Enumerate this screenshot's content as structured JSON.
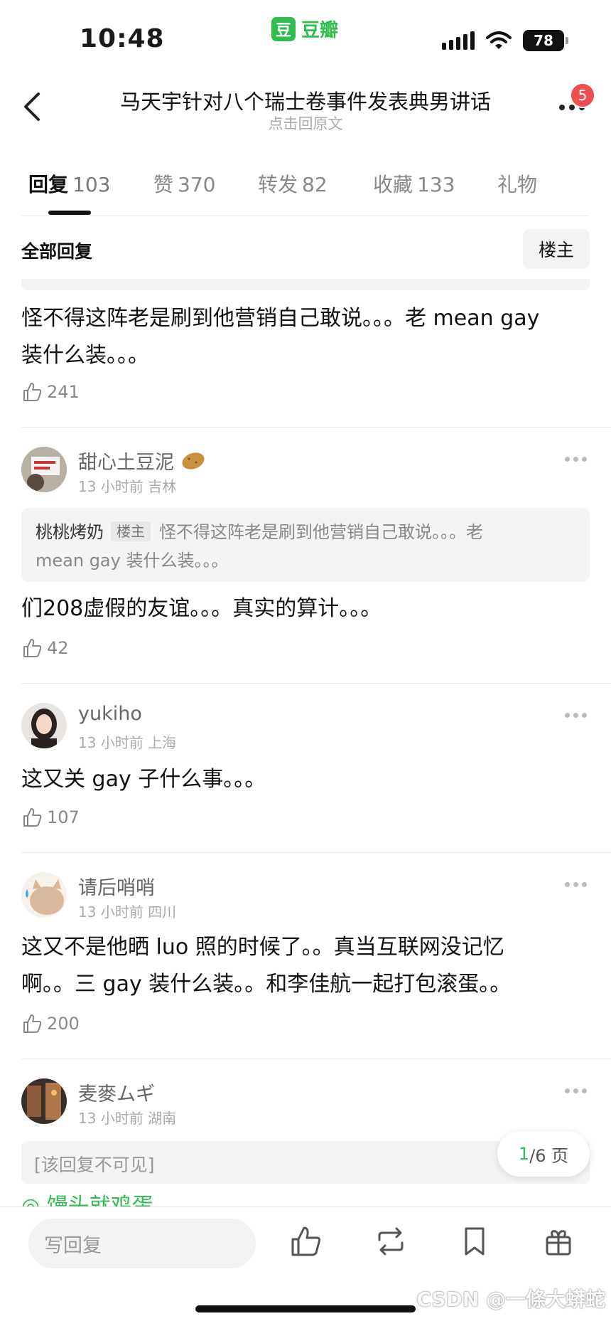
{
  "status_bar": {
    "time": "10:48",
    "app_icon_glyph": "豆",
    "app_name": "豆瓣",
    "battery": "78"
  },
  "nav": {
    "title": "马天宇针对八个瑞士卷事件发表典男讲话",
    "subtitle": "点击回原文",
    "notification_count": "5"
  },
  "tabs": [
    {
      "label": "回复",
      "count": "103",
      "active": true
    },
    {
      "label": "赞",
      "count": "370"
    },
    {
      "label": "转发",
      "count": "82"
    },
    {
      "label": "收藏",
      "count": "133"
    },
    {
      "label": "礼物",
      "count": ""
    }
  ],
  "filter": {
    "label": "全部回复",
    "op_button": "楼主"
  },
  "comments": [
    {
      "text_lines": [
        "怪不得这阵老是刷到他营销自己敢说。。。老 mean gay",
        "装什么装。。。"
      ],
      "likes": "241"
    },
    {
      "username": "甜心土豆泥",
      "time": "13 小时前",
      "location": "吉林",
      "quote": {
        "name": "桃桃烤奶",
        "tag": "楼主",
        "line1": "怪不得这阵老是刷到他营销自己敢说。。。老",
        "line2": "mean gay 装什么装。。。"
      },
      "text": "们208虚假的友谊。。。真实的算计。。。",
      "likes": "42"
    },
    {
      "username": "yukiho",
      "time": "13 小时前",
      "location": "上海",
      "text": "这又关 gay 子什么事。。。",
      "likes": "107"
    },
    {
      "username": "请后哨哨",
      "time": "13 小时前",
      "location": "四川",
      "text_lines": [
        "这又不是他晒 luo 照的时候了。。真当互联网没记忆",
        "啊。。三 gay 装什么装。。和李佳航一起打包滚蛋。。"
      ],
      "likes": "200"
    },
    {
      "username": "麦麥ムギ",
      "time": "13 小时前",
      "location": "湖南",
      "hidden_text": "[该回复不可见]",
      "cut_text": "◎ 馒头就鸡蛋"
    }
  ],
  "pagination": {
    "current": "1",
    "total": "/6 页"
  },
  "bottom_bar": {
    "reply_placeholder": "写回复"
  },
  "watermark": "CSDN @一條大蟒蛇",
  "colors": {
    "accent": "#2dbe4f",
    "badge": "#f04e4e"
  }
}
